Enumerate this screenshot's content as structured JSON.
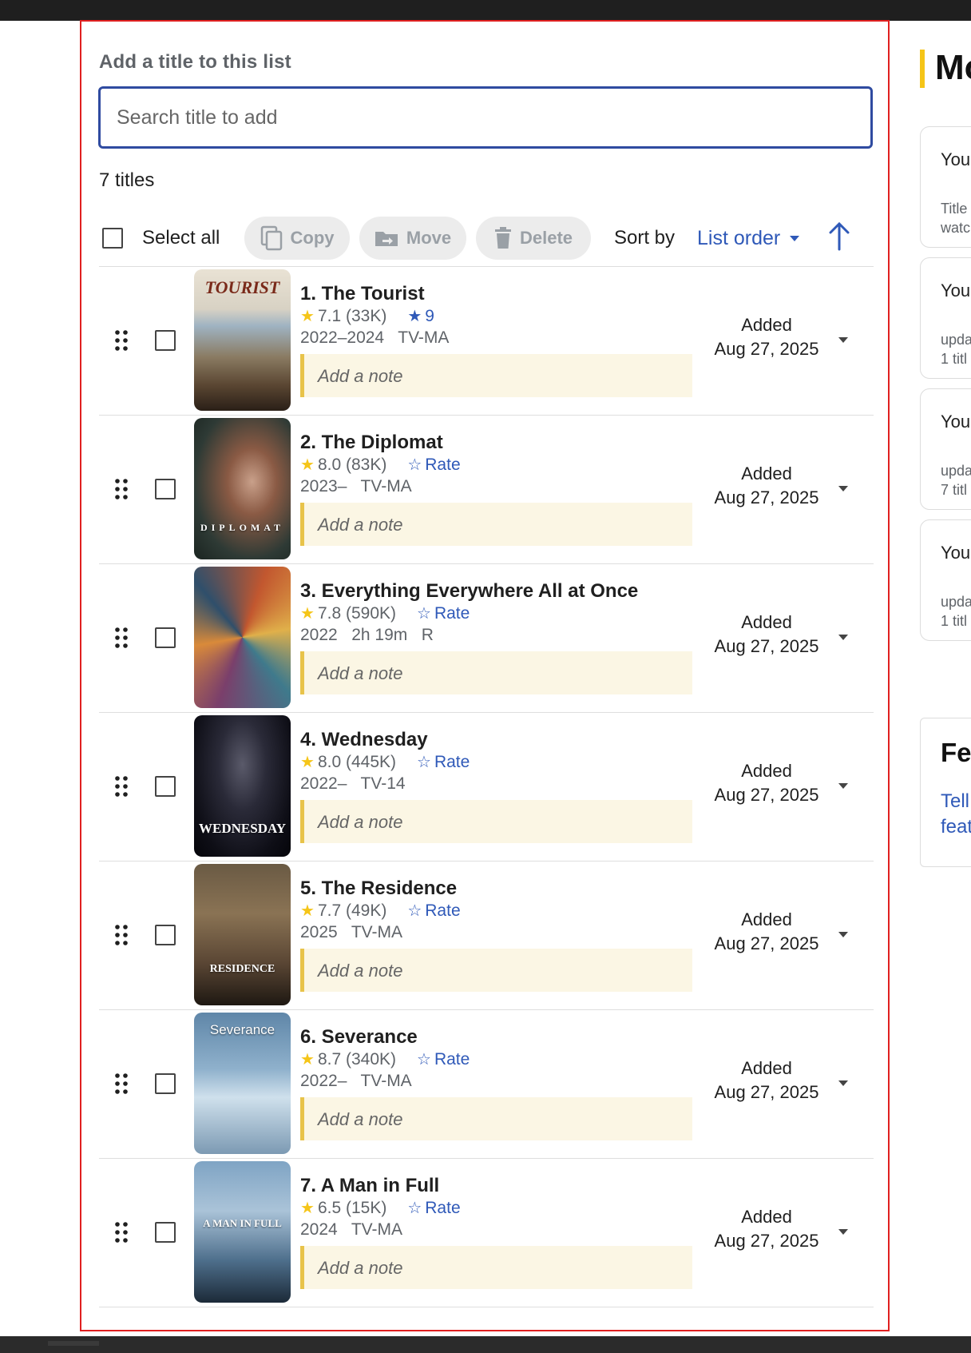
{
  "add_section": {
    "label": "Add a title to this list",
    "search_placeholder": "Search title to add"
  },
  "list_count": "7 titles",
  "toolbar": {
    "select_all": "Select all",
    "copy": "Copy",
    "move": "Move",
    "delete": "Delete",
    "sort_by": "Sort by",
    "sort_value": "List order"
  },
  "items": [
    {
      "title": "1. The Tourist",
      "rating": "7.1 (33K)",
      "your_rating": "9",
      "meta": "2022–2024   TV-MA",
      "note_placeholder": "Add a note",
      "added_label": "Added",
      "added_date": "Aug 27, 2025",
      "poster_text": "TOURIST"
    },
    {
      "title": "2. The Diplomat",
      "rating": "8.0 (83K)",
      "your_rating": "Rate",
      "meta": "2023–   TV-MA",
      "note_placeholder": "Add a note",
      "added_label": "Added",
      "added_date": "Aug 27, 2025",
      "poster_text": "DIPLOMAT"
    },
    {
      "title": "3. Everything Everywhere All at Once",
      "rating": "7.8 (590K)",
      "your_rating": "Rate",
      "meta": "2022   2h 19m   R",
      "note_placeholder": "Add a note",
      "added_label": "Added",
      "added_date": "Aug 27, 2025",
      "poster_text": ""
    },
    {
      "title": "4. Wednesday",
      "rating": "8.0 (445K)",
      "your_rating": "Rate",
      "meta": "2022–   TV-14",
      "note_placeholder": "Add a note",
      "added_label": "Added",
      "added_date": "Aug 27, 2025",
      "poster_text": "WEDNESDAY"
    },
    {
      "title": "5. The Residence",
      "rating": "7.7 (49K)",
      "your_rating": "Rate",
      "meta": "2025   TV-MA",
      "note_placeholder": "Add a note",
      "added_label": "Added",
      "added_date": "Aug 27, 2025",
      "poster_text": "RESIDENCE"
    },
    {
      "title": "6. Severance",
      "rating": "8.7 (340K)",
      "your_rating": "Rate",
      "meta": "2022–   TV-MA",
      "note_placeholder": "Add a note",
      "added_label": "Added",
      "added_date": "Aug 27, 2025",
      "poster_text": "Severance"
    },
    {
      "title": "7. A Man in Full",
      "rating": "6.5 (15K)",
      "your_rating": "Rate",
      "meta": "2024   TV-MA",
      "note_placeholder": "Add a note",
      "added_label": "Added",
      "added_date": "Aug 27, 2025",
      "poster_text": "A MAN IN FULL"
    }
  ],
  "sidebar": {
    "title": "Mo",
    "cards": [
      {
        "title": "Your",
        "sub1": "Title",
        "sub2": "watc"
      },
      {
        "title": "Your",
        "sub1": "upda",
        "sub2": "1 titl"
      },
      {
        "title": "Your",
        "sub1": "upda",
        "sub2": "7 titl"
      },
      {
        "title": "Your",
        "sub1": "upda",
        "sub2": "1 titl"
      }
    ],
    "feedback": {
      "title": "Fe",
      "link1": "Tell",
      "link2": "feat"
    }
  },
  "colors": {
    "accent_blue": "#2f59b8",
    "imdb_yellow": "#f5c518",
    "frame_red": "#e02020",
    "note_bg": "#fbf6e4"
  }
}
